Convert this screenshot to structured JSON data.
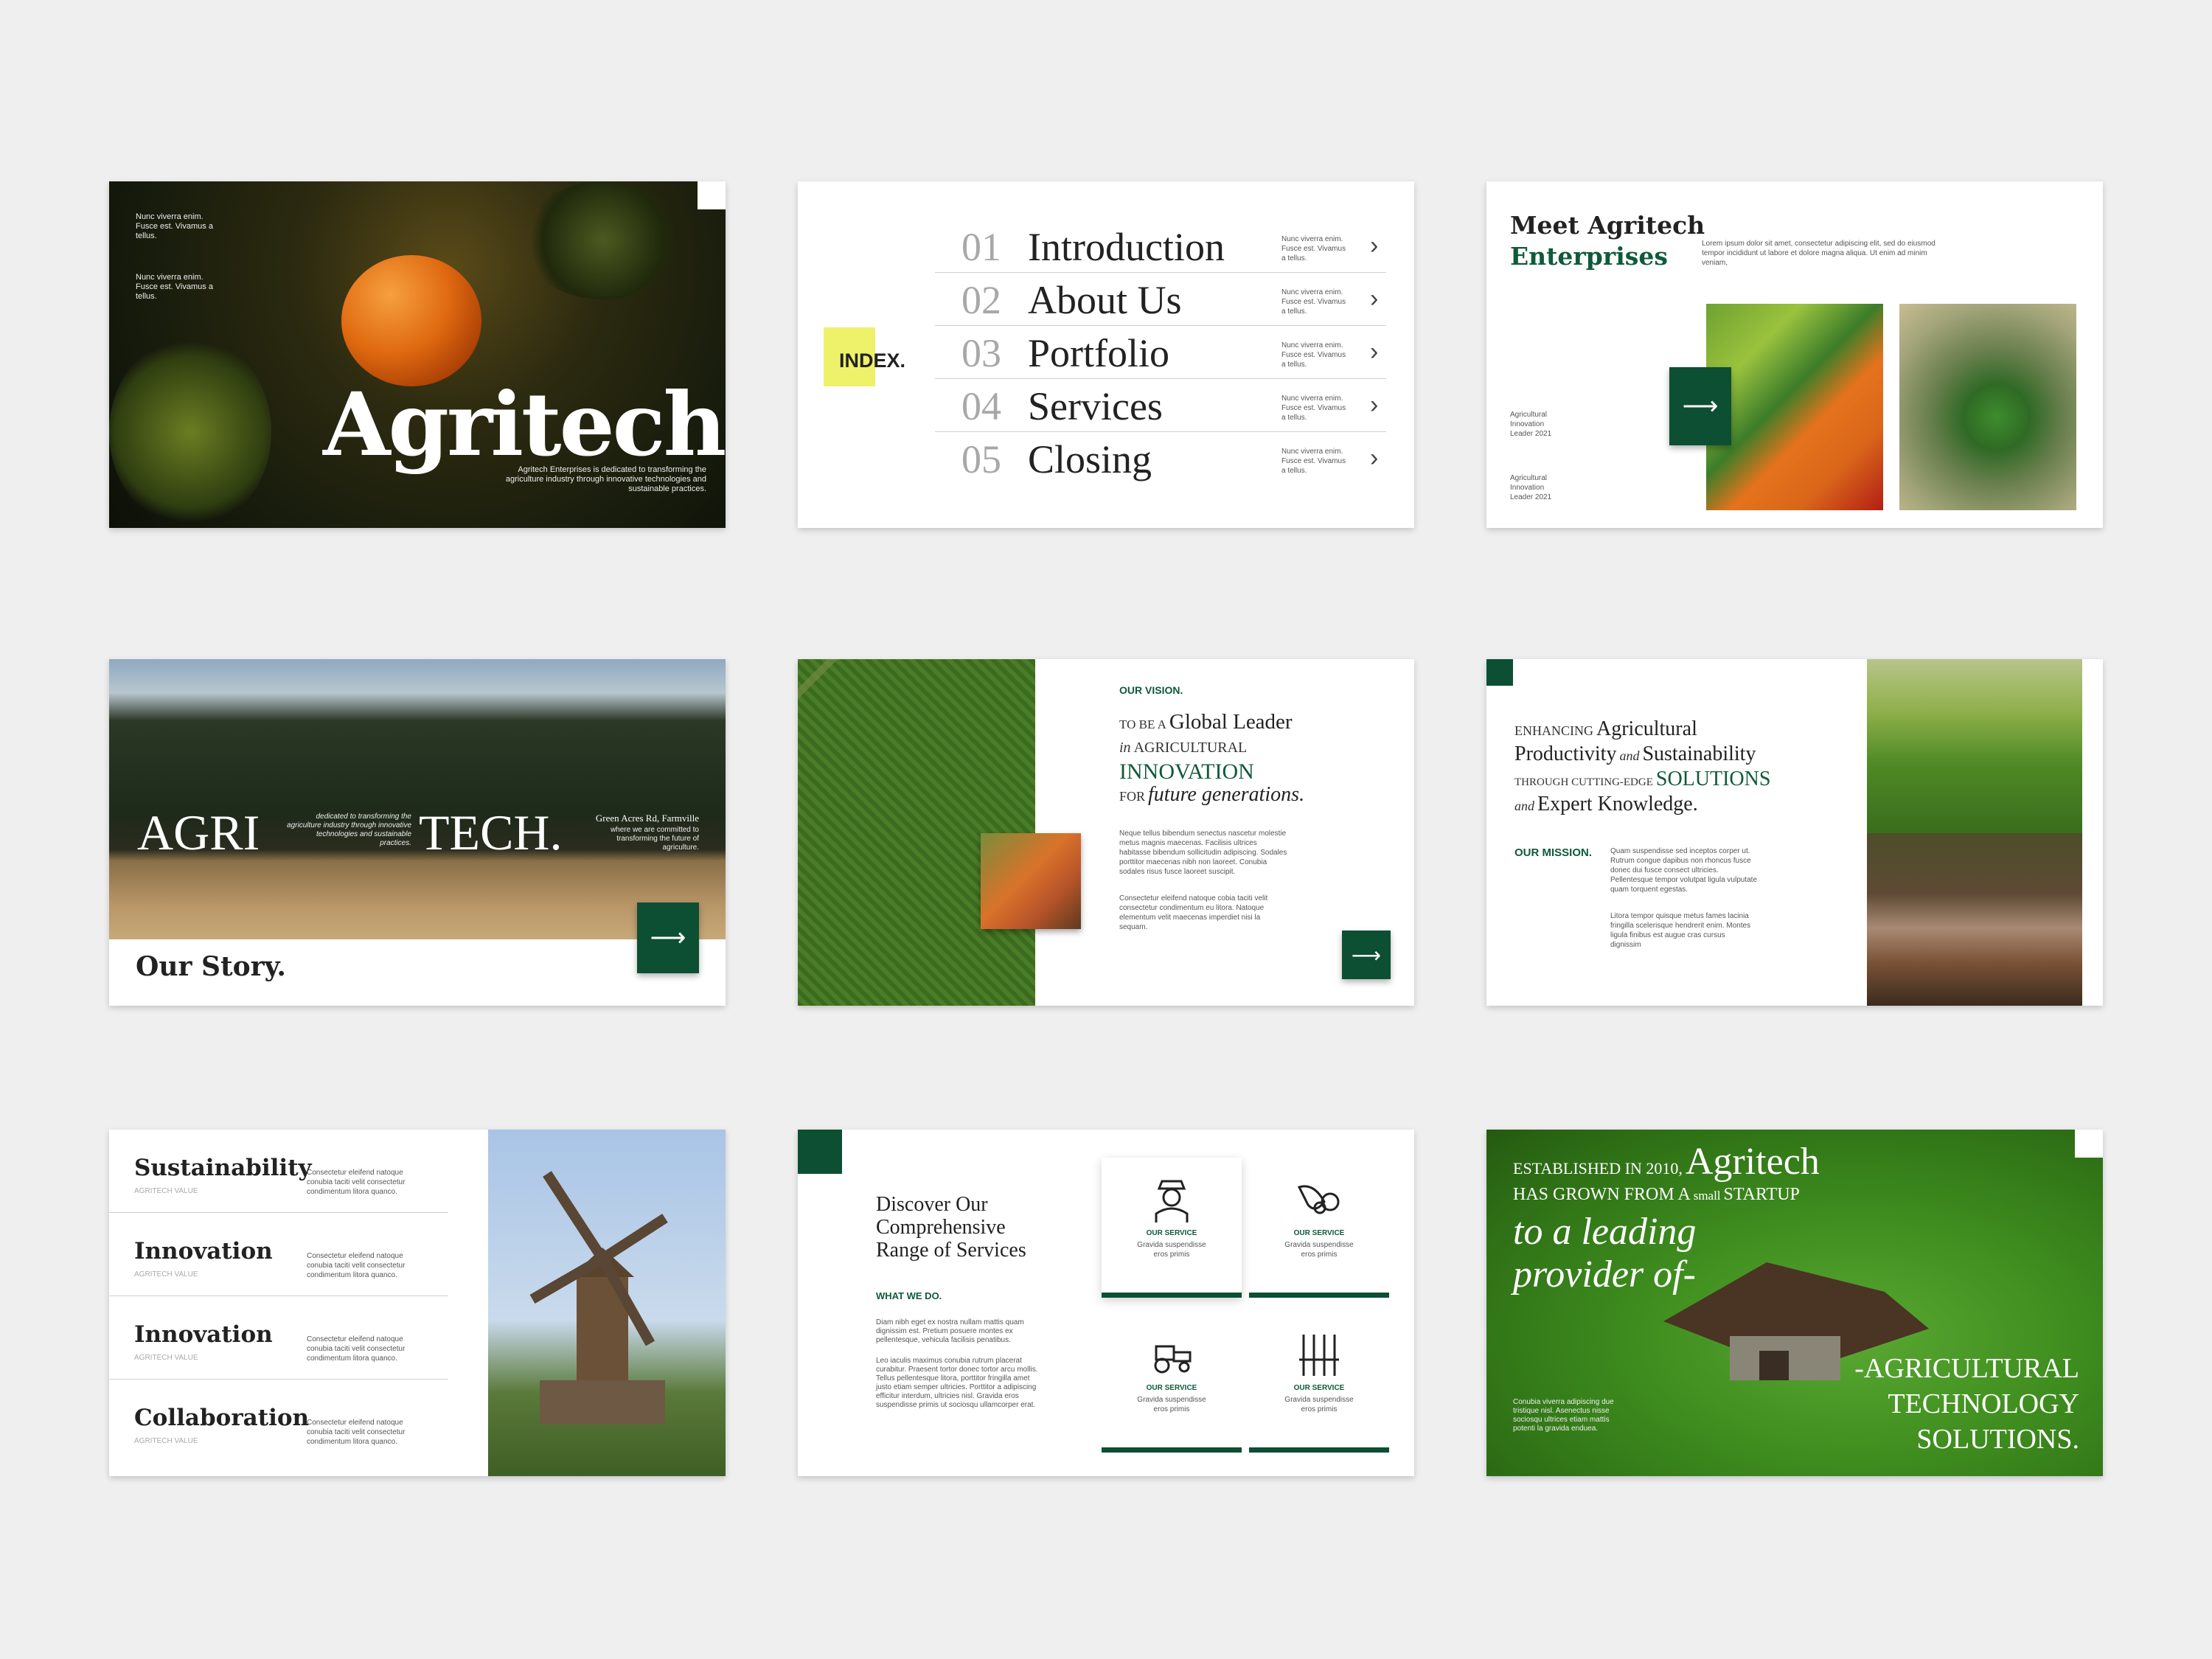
{
  "colors": {
    "accent": "#0f5a3a",
    "highlight": "#eef26a",
    "background": "#efefef"
  },
  "s1": {
    "note1": "Nunc viverra enim. Fusce est. Vivamus a tellus.",
    "note2": "Nunc viverra enim. Fusce est. Vivamus a tellus.",
    "title": "Agritech.",
    "desc": "Agritech Enterprises is dedicated to transforming the agriculture industry through innovative technologies and sustainable practices."
  },
  "s2": {
    "index_label": "INDEX.",
    "items": [
      {
        "num": "01",
        "label": "Introduction",
        "note": "Nunc viverra enim. Fusce est. Vivamus a tellus."
      },
      {
        "num": "02",
        "label": "About Us",
        "note": "Nunc viverra enim. Fusce est. Vivamus a tellus."
      },
      {
        "num": "03",
        "label": "Portfolio",
        "note": "Nunc viverra enim. Fusce est. Vivamus a tellus."
      },
      {
        "num": "04",
        "label": "Services",
        "note": "Nunc viverra enim. Fusce est. Vivamus a tellus."
      },
      {
        "num": "05",
        "label": "Closing",
        "note": "Nunc viverra enim. Fusce est. Vivamus a tellus."
      }
    ]
  },
  "s3": {
    "title1": "Meet Agritech",
    "title2": "Enterprises",
    "desc": "Lorem ipsum dolor sit amet, consectetur adipiscing elit, sed do eiusmod tempor incididunt ut labore et dolore magna aliqua. Ut enim ad minim veniam,",
    "caption1": "Agricultural Innovation Leader 2021",
    "caption2": "Agricultural Innovation Leader 2021"
  },
  "s4": {
    "agri": "AGRI",
    "tech": "TECH.",
    "mid_note": "dedicated to transforming the agriculture industry through innovative technologies and sustainable practices.",
    "address": "Green Acres Rd, Farmville",
    "address_note": "where we are committed to transforming the future of agriculture.",
    "title": "Our Story."
  },
  "s5": {
    "label": "OUR VISION.",
    "l1a": "TO BE A",
    "l1b": "Global Leader",
    "l2a": "in",
    "l2b": "AGRICULTURAL",
    "l3": "INNOVATION",
    "l4a": "FOR",
    "l4b": "future generations.",
    "p1": "Neque tellus bibendum senectus nascetur molestie metus magnis maecenas. Facilisis ultrices habitasse bibendum sollicitudin adipiscing. Sodales porttitor maecenas nibh non laoreet. Conubia sodales risus fusce laoreet suscipit.",
    "p2": "Consectetur eleifend natoque cobia taciti velit consectetur condimentum eu litora. Natoque elementum velit maecenas imperdiet nisi la sequam."
  },
  "s6": {
    "l1a": "ENHANCING",
    "l1b": "Agricultural",
    "l2a": "Productivity",
    "l2b": "and",
    "l2c": "Sustainability",
    "l3a": "THROUGH CUTTING-EDGE",
    "l3b": "SOLUTIONS",
    "l4a": "and",
    "l4b": "Expert Knowledge.",
    "mission": "OUR MISSION.",
    "p1": "Quam suspendisse sed inceptos corper ut. Rutrum congue dapibus non rhoncus fusce donec dui fusce consect ultricies. Pellentesque tempor volutpat ligula vulputate quam torquent egestas.",
    "p2": "Litora tempor quisque metus fames lacinia fringilla scelerisque hendrerit enim. Montes ligula finibus est augue cras cursus dignissim"
  },
  "s7": {
    "values": [
      {
        "title": "Sustainability",
        "sub": "AGRITECH VALUE",
        "desc": "Consectetur eleifend natoque conubia taciti velit consectetur condimentum litora quanco."
      },
      {
        "title": "Innovation",
        "sub": "AGRITECH VALUE",
        "desc": "Consectetur eleifend natoque conubia taciti velit consectetur condimentum litora quanco."
      },
      {
        "title": "Innovation",
        "sub": "AGRITECH VALUE",
        "desc": "Consectetur eleifend natoque conubia taciti velit consectetur condimentum litora quanco."
      },
      {
        "title": "Collaboration",
        "sub": "AGRITECH VALUE",
        "desc": "Consectetur eleifend natoque conubia taciti velit consectetur condimentum litora quanco."
      }
    ]
  },
  "s8": {
    "title": "Discover Our Comprehensive Range of Services",
    "what": "WHAT WE DO.",
    "p1": "Diam nibh eget ex nostra nullam mattis quam dignissim est. Pretium posuere montes ex pellentesque, vehicula facilisis penatibus.",
    "p2": "Leo iaculis maximus conubia rutrum placerat curabitur. Praesent tortor donec tortor arcu mollis. Tellus pellentesque litora, porttitor fringilla amet justo etiam semper ultricies. Porttitor a adipiscing efficitur interdum, ultricies nisl. Gravida eros suspendisse primis ut sociosqu ullamcorper erat.",
    "services": [
      {
        "icon": "farmer-icon",
        "label": "OUR SERVICE",
        "desc": "Gravida suspendisse eros primis"
      },
      {
        "icon": "harvest-icon",
        "label": "OUR SERVICE",
        "desc": "Gravida suspendisse eros primis"
      },
      {
        "icon": "tractor-icon",
        "label": "OUR SERVICE",
        "desc": "Gravida suspendisse eros primis"
      },
      {
        "icon": "wheat-icon",
        "label": "OUR SERVICE",
        "desc": "Gravida suspendisse eros primis"
      }
    ]
  },
  "s9": {
    "l1a": "ESTABLISHED IN 2010,",
    "l1b": "Agritech",
    "l2a": "HAS GROWN FROM A",
    "l2b": "small",
    "l2c": "STARTUP",
    "l3": "to a leading",
    "l4": "provider of-",
    "r1": "-AGRICULTURAL",
    "r2": "TECHNOLOGY",
    "r3": "SOLUTIONS.",
    "note": "Conubia viverra adipiscing due tristique nisl. Asenectus nisse sociosqu ultrices etiam mattis potenti la gravida enduea."
  }
}
